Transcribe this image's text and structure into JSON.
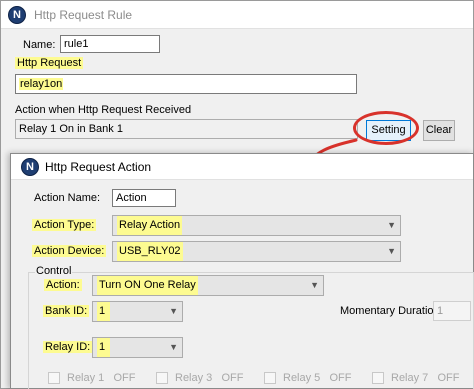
{
  "outer": {
    "title": "Http Request Rule",
    "app_icon_letter": "N",
    "name_label": "Name:",
    "name_value": "rule1",
    "http_request_label": "Http Request",
    "http_request_value": "relay1on",
    "action_received_label": "Action when Http Request Received",
    "action_received_value": "Relay 1 On in Bank 1",
    "setting_button": "Setting",
    "clear_button": "Clear"
  },
  "inner": {
    "title": "Http Request Action",
    "app_icon_letter": "N",
    "action_name_label": "Action Name:",
    "action_name_value": "Action",
    "action_type_label": "Action Type:",
    "action_type_value": "Relay Action",
    "action_device_label": "Action Device:",
    "action_device_value": "USB_RLY02",
    "control_group_label": "Control",
    "action_label": "Action:",
    "action_value": "Turn ON One Relay",
    "bank_id_label": "Bank ID:",
    "bank_id_value": "1",
    "momentary_label": "Momentary Duration:",
    "momentary_value": "1",
    "relay_id_label": "Relay ID:",
    "relay_id_value": "1",
    "relays": [
      {
        "label": "Relay 1",
        "state": "OFF"
      },
      {
        "label": "Relay 3",
        "state": "OFF"
      },
      {
        "label": "Relay 5",
        "state": "OFF"
      },
      {
        "label": "Relay 7",
        "state": "OFF"
      }
    ]
  },
  "colors": {
    "highlight": "#fdfb91",
    "callout_red": "#d8322b",
    "focus_blue": "#0078d7"
  },
  "icons": {
    "dropdown": "chevron-down-icon",
    "app": "app-logo-icon"
  }
}
